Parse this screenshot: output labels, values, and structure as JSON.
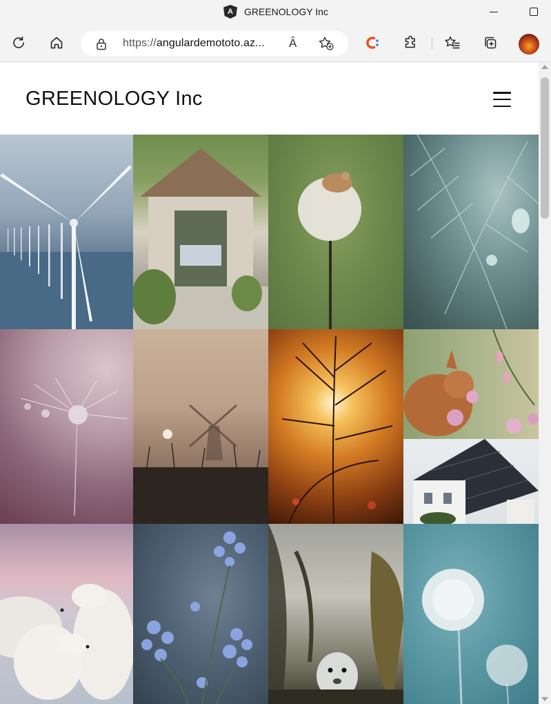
{
  "browser": {
    "tab_title": "GREENOLOGY Inc",
    "app_icon_glyph": "A",
    "url_prefix": "https://",
    "url_host": "angulardemototo.az...",
    "read_aloud_glyph": "Ȃ",
    "window_buttons": [
      "minimize",
      "maximize"
    ],
    "toolbar_icons": [
      "refresh-icon",
      "home-icon",
      "lock-icon",
      "read-aloud-icon",
      "add-favorite-icon",
      "coupons-extension-icon",
      "extensions-icon",
      "favorites-icon",
      "collections-icon",
      "profile-avatar"
    ]
  },
  "site": {
    "title": "GREENOLOGY Inc",
    "menu_icon": "hamburger-menu-icon"
  },
  "gallery": {
    "images": [
      {
        "subject": "wind-turbines-at-sea"
      },
      {
        "subject": "garden-greenhouse-shed"
      },
      {
        "subject": "mouse-on-dandelion"
      },
      {
        "subject": "dew-on-fern"
      },
      {
        "subject": "dandelion-seed-with-droplet"
      },
      {
        "subject": "windmill-in-fog"
      },
      {
        "subject": "grass-at-sunset"
      },
      {
        "subject": "squirrel-with-flowers"
      },
      {
        "subject": "house-with-solar-roof"
      },
      {
        "subject": "polar-bears"
      },
      {
        "subject": "blue-flowers"
      },
      {
        "subject": "seal-in-kelp"
      },
      {
        "subject": "dandelion-clocks"
      }
    ]
  },
  "colors": {
    "chrome_background": "#f3f3f3",
    "page_background": "#ffffff",
    "title_text": "#111111",
    "coupon_icon_orange": "#e8562a",
    "coupon_icon_blue": "#3d7de0"
  }
}
